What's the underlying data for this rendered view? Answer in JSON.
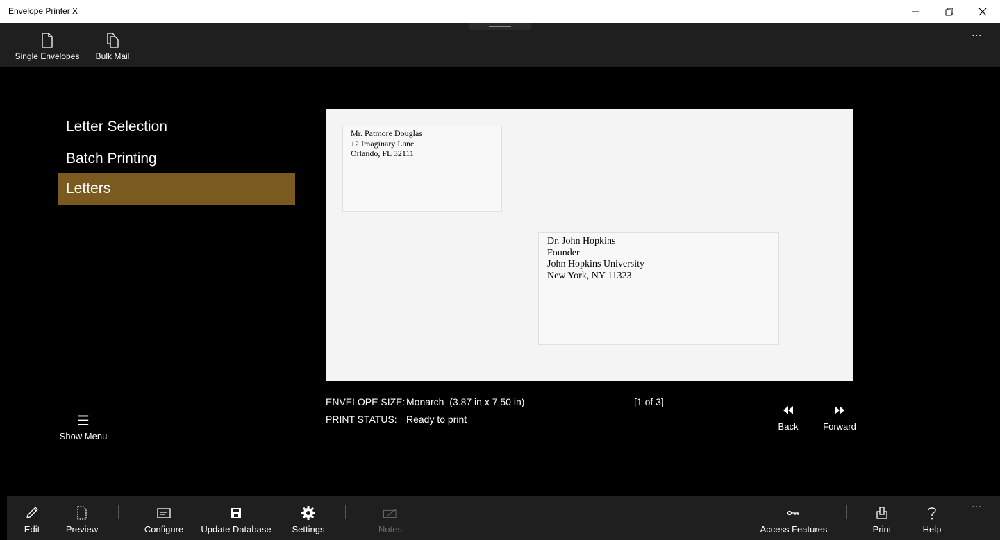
{
  "window": {
    "title": "Envelope Printer X"
  },
  "top_commands": {
    "single_envelopes": "Single Envelopes",
    "bulk_mail": "Bulk Mail",
    "more": "..."
  },
  "nav": {
    "items": [
      {
        "label": "Letter Selection"
      },
      {
        "label": "Batch Printing"
      },
      {
        "label": "Letters",
        "selected": true
      }
    ],
    "show_menu": "Show Menu",
    "accent": "#7a5a1f"
  },
  "envelope": {
    "return_address": [
      "Mr. Patmore Douglas",
      "12 Imaginary Lane",
      "Orlando, FL 32111"
    ],
    "recipient_address": [
      "Dr. John Hopkins",
      "Founder",
      "John Hopkins University",
      "New York, NY 11323"
    ]
  },
  "info": {
    "size_label": "ENVELOPE SIZE:",
    "size_value": "Monarch  (3.87 in x 7.50 in)",
    "status_label": "PRINT STATUS:",
    "status_value": "Ready to print",
    "pager": "[1 of 3]",
    "back": "Back",
    "forward": "Forward"
  },
  "bottom_commands": {
    "edit": "Edit",
    "preview": "Preview",
    "configure": "Configure",
    "update_database": "Update Database",
    "settings": "Settings",
    "notes": "Notes",
    "access_features": "Access Features",
    "print": "Print",
    "help": "Help",
    "more": "..."
  }
}
